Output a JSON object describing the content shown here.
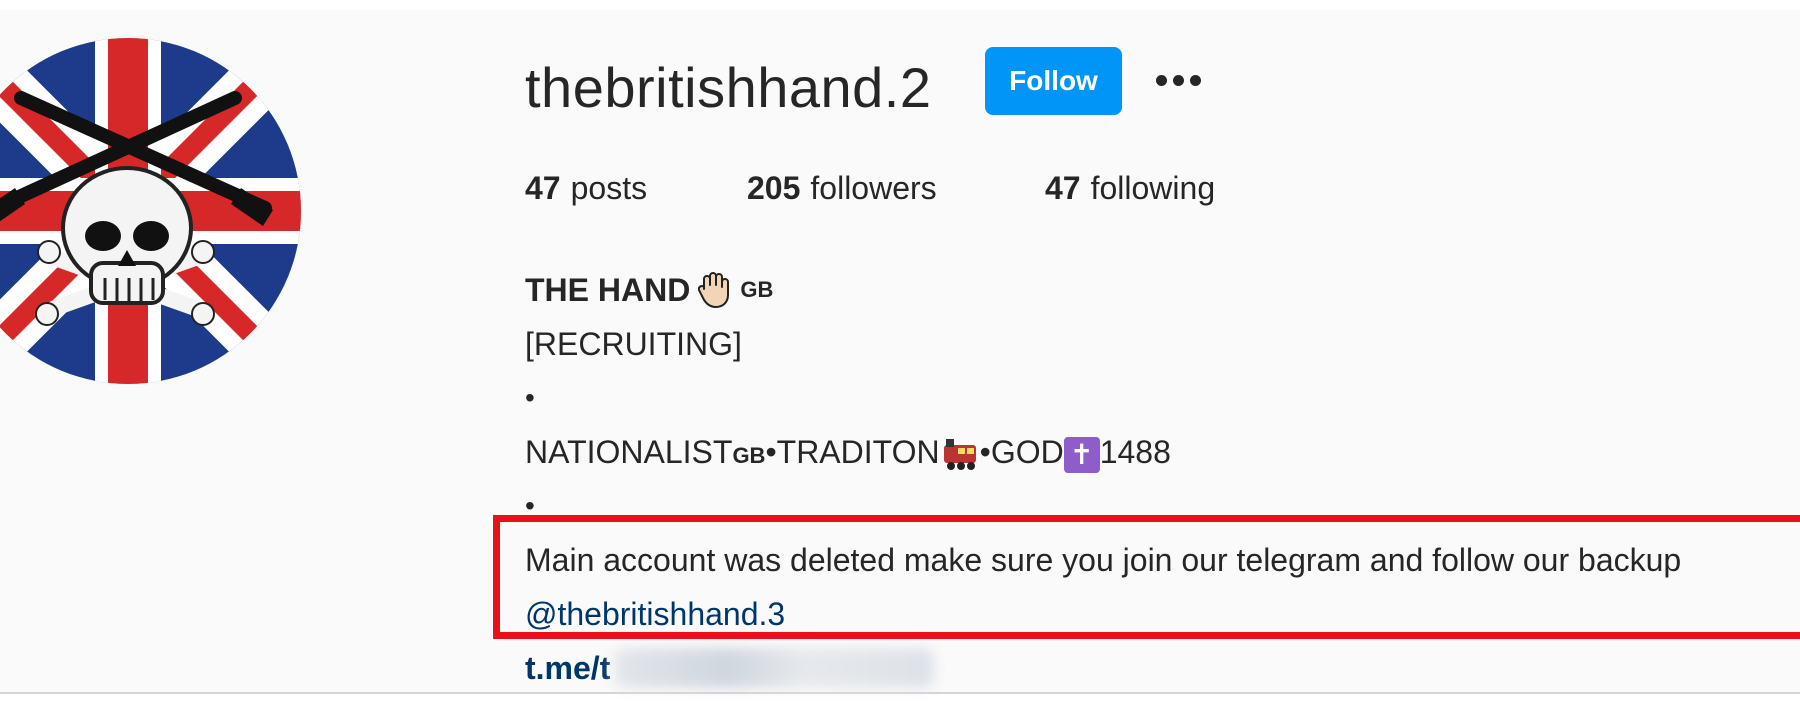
{
  "profile": {
    "username": "thebritishhand.2",
    "follow_label": "Follow",
    "more_icon": "more-options-icon"
  },
  "stats": {
    "posts_count": "47",
    "posts_label": "posts",
    "followers_count": "205",
    "followers_label": "followers",
    "following_count": "47",
    "following_label": "following"
  },
  "bio": {
    "name": "THE HAND",
    "name_icon": "raised-hand-icon",
    "name_flag": "GB",
    "line_recruiting": "[RECRUITING]",
    "bullet": "•",
    "nationalist": "NATIONALIST",
    "nationalist_flag": "GB",
    "tradition": "•TRADITON",
    "train_icon": "train-icon",
    "god": "•GOD",
    "cross_icon": "latin-cross-icon",
    "number": "1488",
    "notice": "Main account was deleted make sure you join our telegram and follow our backup",
    "mention": "@thebritishhand.3",
    "link_prefix": "t.me/t"
  },
  "colors": {
    "follow_button": "#0095f6",
    "highlight_border": "#e8101b",
    "mention": "#00376b",
    "background": "#fafafa"
  }
}
